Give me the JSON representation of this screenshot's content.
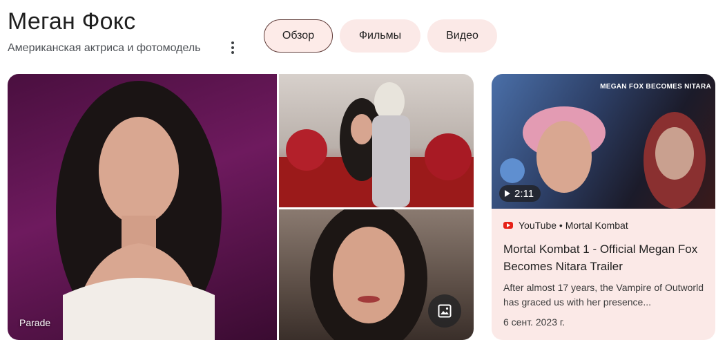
{
  "entity": {
    "title": "Меган Фокс",
    "subtitle": "Американская актриса и фотомодель"
  },
  "tabs": [
    {
      "label": "Обзор",
      "active": true
    },
    {
      "label": "Фильмы",
      "active": false
    },
    {
      "label": "Видео",
      "active": false
    }
  ],
  "images": {
    "main_source": "Parade",
    "image_search_icon": "image-icon"
  },
  "video_card": {
    "thumbnail_caption": "MEGAN FOX BECOMES NITARA",
    "duration": "2:11",
    "source_icon": "youtube-icon",
    "source": "YouTube • Mortal Kombat",
    "title": "Mortal Kombat 1 - Official Megan Fox Becomes Nitara Trailer",
    "description": "After almost 17 years, the Vampire of Outworld has graced us with her presence...",
    "date": "6 сент. 2023 г."
  },
  "colors": {
    "chip_bg": "#fbe9e7",
    "card_bg": "#fbe9e7",
    "youtube_red": "#e62117"
  }
}
